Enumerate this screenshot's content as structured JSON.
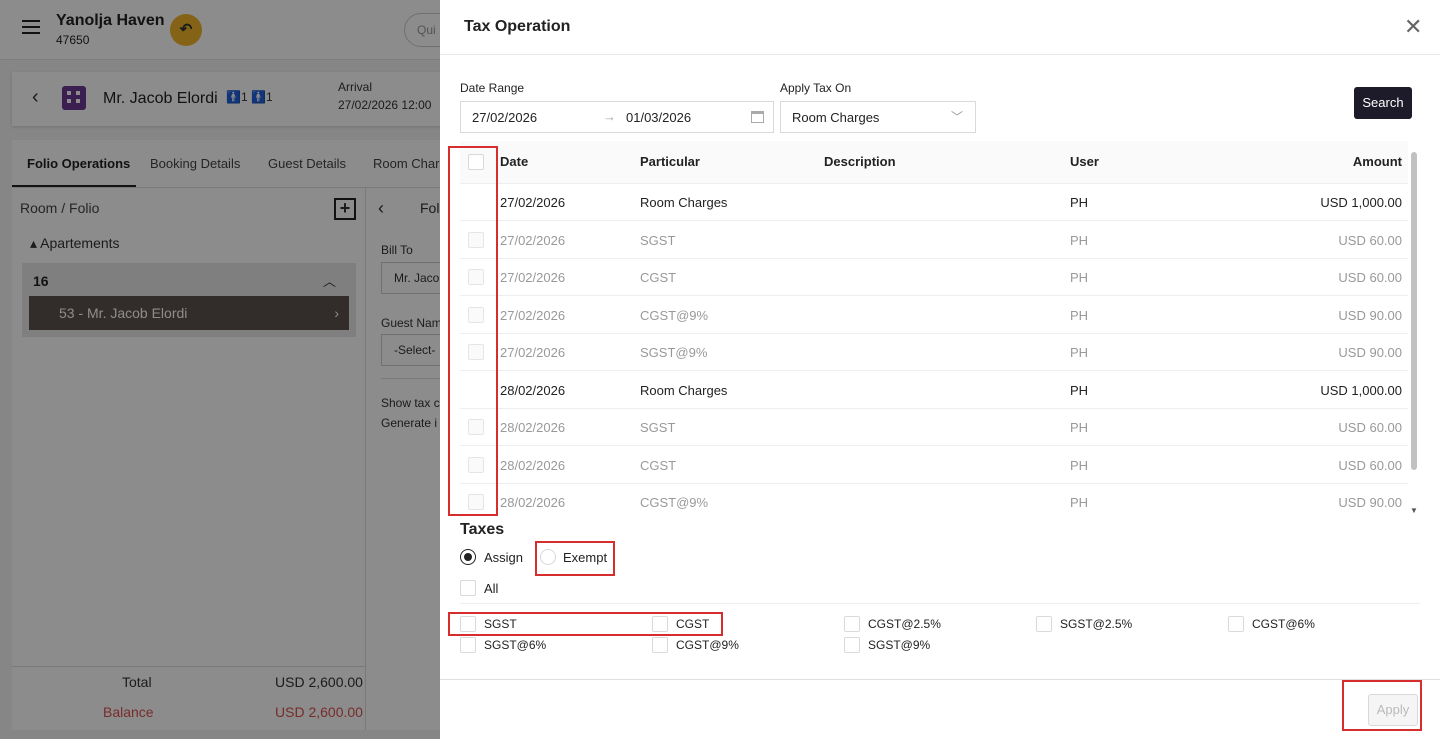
{
  "app": {
    "hotel_name": "Yanolja Haven",
    "hotel_id": "47650",
    "quick_search_placeholder": "Qui",
    "guest": {
      "name": "Mr. Jacob Elordi",
      "adults": "1",
      "children": "1",
      "arrival_label": "Arrival",
      "arrival_value": "27/02/2026 12:00"
    },
    "tabs": [
      "Folio Operations",
      "Booking Details",
      "Guest Details",
      "Room Charg"
    ],
    "folio_header": "Room / Folio",
    "apartments_label": "Apartements",
    "room_number": "16",
    "folio_item": "53 - Mr. Jacob Elordi",
    "right_col_label": "Fol",
    "bill_to_label": "Bill To",
    "bill_to_value": "Mr. Jaco",
    "guest_name_label": "Guest Nam",
    "guest_name_value": "-Select-",
    "show_tax": "Show tax c",
    "generate": "Generate i",
    "total_label": "Total",
    "total_value": "USD 2,600.00",
    "balance_label": "Balance",
    "balance_value": "USD 2,600.00"
  },
  "drawer": {
    "title": "Tax Operation",
    "date_range_label": "Date Range",
    "date_from": "27/02/2026",
    "date_to": "01/03/2026",
    "apply_tax_on_label": "Apply Tax On",
    "apply_tax_on_value": "Room Charges",
    "search_label": "Search",
    "columns": {
      "date": "Date",
      "particular": "Particular",
      "description": "Description",
      "user": "User",
      "amount": "Amount"
    },
    "rows": [
      {
        "date": "27/02/2026",
        "particular": "Room Charges",
        "description": "",
        "user": "PH",
        "amount": "USD 1,000.00",
        "disabled": false
      },
      {
        "date": "27/02/2026",
        "particular": "SGST",
        "description": "",
        "user": "PH",
        "amount": "USD 60.00",
        "disabled": true
      },
      {
        "date": "27/02/2026",
        "particular": "CGST",
        "description": "",
        "user": "PH",
        "amount": "USD 60.00",
        "disabled": true
      },
      {
        "date": "27/02/2026",
        "particular": "CGST@9%",
        "description": "",
        "user": "PH",
        "amount": "USD 90.00",
        "disabled": true
      },
      {
        "date": "27/02/2026",
        "particular": "SGST@9%",
        "description": "",
        "user": "PH",
        "amount": "USD 90.00",
        "disabled": true
      },
      {
        "date": "28/02/2026",
        "particular": "Room Charges",
        "description": "",
        "user": "PH",
        "amount": "USD 1,000.00",
        "disabled": false
      },
      {
        "date": "28/02/2026",
        "particular": "SGST",
        "description": "",
        "user": "PH",
        "amount": "USD 60.00",
        "disabled": true
      },
      {
        "date": "28/02/2026",
        "particular": "CGST",
        "description": "",
        "user": "PH",
        "amount": "USD 60.00",
        "disabled": true
      },
      {
        "date": "28/02/2026",
        "particular": "CGST@9%",
        "description": "",
        "user": "PH",
        "amount": "USD 90.00",
        "disabled": true
      }
    ],
    "taxes_title": "Taxes",
    "assign_label": "Assign",
    "exempt_label": "Exempt",
    "all_label": "All",
    "tax_options": [
      "SGST",
      "CGST",
      "CGST@2.5%",
      "SGST@2.5%",
      "CGST@6%",
      "SGST@6%",
      "CGST@9%",
      "SGST@9%"
    ],
    "apply_label": "Apply"
  },
  "colors": {
    "accent": "#1d1b29",
    "highlight": "#d62d2d",
    "undo": "#f0b429",
    "folio_item": "#5c524f"
  }
}
